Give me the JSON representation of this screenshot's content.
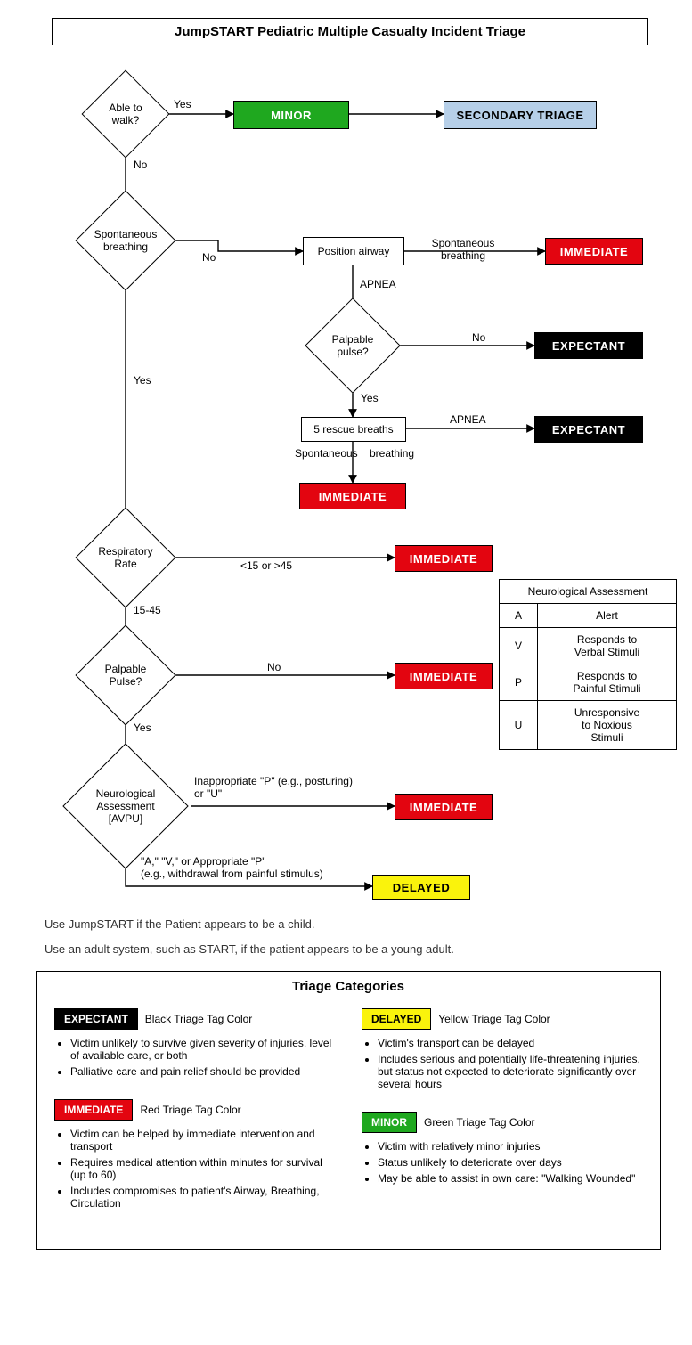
{
  "title": "JumpSTART Pediatric Multiple Casualty Incident Triage",
  "nodes": {
    "walk": "Able to\nwalk?",
    "minor": "MINOR",
    "secondary": "SECONDARY TRIAGE",
    "spont_breath": "Spontaneous\nbreathing",
    "position_airway": "Position airway",
    "immediate1": "IMMEDIATE",
    "palp_pulse1": "Palpable\npulse?",
    "expectant1": "EXPECTANT",
    "rescue": "5 rescue breaths",
    "expectant2": "EXPECTANT",
    "immediate2": "IMMEDIATE",
    "resp_rate": "Respiratory\nRate",
    "immediate3": "IMMEDIATE",
    "palp_pulse2": "Palpable\nPulse?",
    "immediate4": "IMMEDIATE",
    "neuro": "Neurological\nAssessment\n[AVPU]",
    "immediate5": "IMMEDIATE",
    "delayed": "DELAYED"
  },
  "edges": {
    "walk_yes": "Yes",
    "walk_no": "No",
    "sb_no": "No",
    "sb_yes": "Yes",
    "pa_spont": "Spontaneous\nbreathing",
    "pa_apnea": "APNEA",
    "pp1_no": "No",
    "pp1_yes": "Yes",
    "rescue_apnea": "APNEA",
    "rescue_spont": "Spontaneous    breathing",
    "rr_bad": "<15 or >45",
    "rr_good": "15-45",
    "pp2_no": "No",
    "pp2_yes": "Yes",
    "neuro_bad": "Inappropriate \"P\" (e.g., posturing)\nor \"U\"",
    "neuro_good": "\"A,\" \"V,\" or Appropriate \"P\"\n(e.g., withdrawal from painful stimulus)"
  },
  "avpu": {
    "header": "Neurological Assessment",
    "rows": [
      {
        "code": "A",
        "desc": "Alert"
      },
      {
        "code": "V",
        "desc": "Responds to\nVerbal Stimuli"
      },
      {
        "code": "P",
        "desc": "Responds to\nPainful Stimuli"
      },
      {
        "code": "U",
        "desc": "Unresponsive\nto Noxious\nStimuli"
      }
    ]
  },
  "notes": {
    "n1": "Use JumpSTART if the Patient appears to be a child.",
    "n2": "Use an adult system, such as START, if the patient appears to be a young adult."
  },
  "legend": {
    "title": "Triage Categories",
    "expectant": {
      "label": "EXPECTANT",
      "color_text": "Black Triage Tag Color",
      "points": [
        "Victim unlikely to survive given severity of injuries, level of available care, or both",
        "Palliative care and pain relief should be provided"
      ]
    },
    "immediate": {
      "label": "IMMEDIATE",
      "color_text": "Red Triage Tag Color",
      "points": [
        "Victim can be helped by immediate intervention and transport",
        "Requires medical attention within minutes for survival (up to 60)",
        "Includes compromises to patient's Airway, Breathing, Circulation"
      ]
    },
    "delayed": {
      "label": "DELAYED",
      "color_text": "Yellow Triage Tag Color",
      "points": [
        "Victim's transport can be delayed",
        "Includes serious and potentially life-threatening injuries, but status not expected to deteriorate significantly over several hours"
      ]
    },
    "minor": {
      "label": "MINOR",
      "color_text": "Green Triage Tag Color",
      "points": [
        "Victim with relatively minor injuries",
        "Status unlikely to deteriorate over days",
        "May be able to assist in own care: \"Walking Wounded\""
      ]
    }
  }
}
